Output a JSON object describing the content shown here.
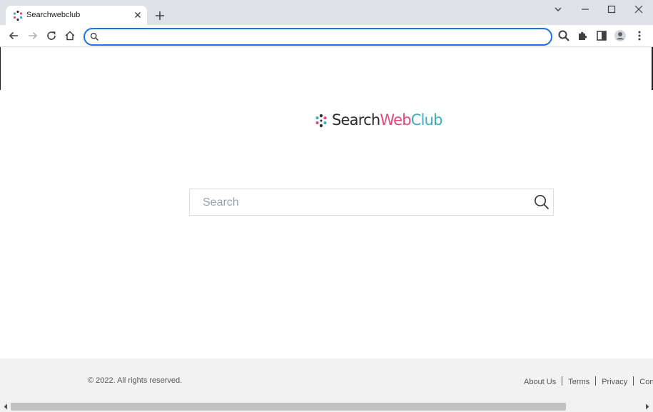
{
  "browser": {
    "tab": {
      "title": "Searchwebclub"
    },
    "omnibox": {
      "value": "",
      "placeholder": ""
    }
  },
  "page": {
    "logo": {
      "part1": "Search",
      "part2": "Web",
      "part3": "Club"
    },
    "search": {
      "placeholder": "Search",
      "value": ""
    },
    "footer": {
      "copyright": "© 2022. All rights reserved.",
      "links": [
        "About Us",
        "Terms",
        "Privacy",
        "Contac"
      ]
    }
  },
  "colors": {
    "omnibox_focus": "#1a73e8",
    "logo_dark": "#2b2b2b",
    "logo_pink": "#e5467c",
    "logo_teal": "#3aafb9",
    "footer_bg": "#f2f2f2"
  },
  "icons": [
    "favicon-icon",
    "close-icon",
    "plus-icon",
    "chevron-down-icon",
    "minimize-icon",
    "maximize-icon",
    "window-close-icon",
    "back-arrow-icon",
    "forward-arrow-icon",
    "reload-icon",
    "home-icon",
    "search-icon",
    "extensions-icon",
    "side-panel-icon",
    "profile-icon",
    "more-vert-icon",
    "magnifier-icon"
  ]
}
